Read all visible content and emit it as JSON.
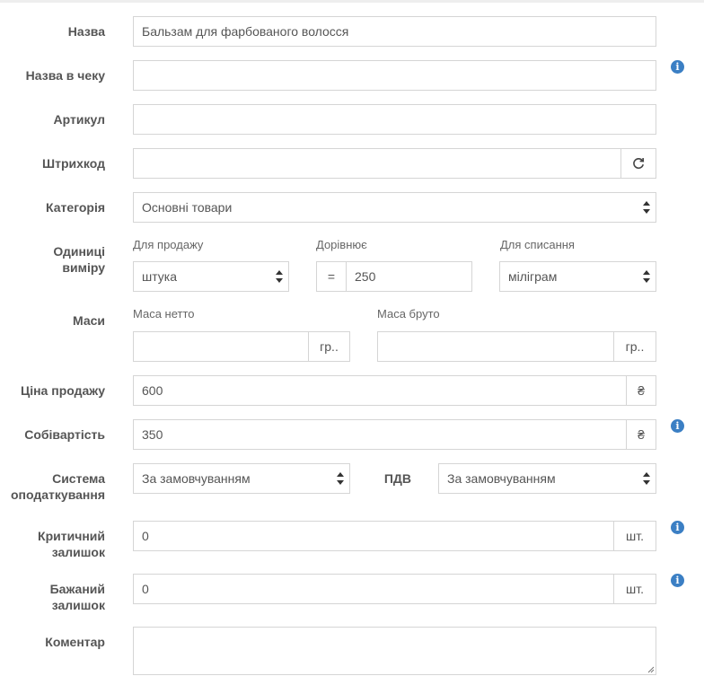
{
  "fields": {
    "name": {
      "label": "Назва",
      "value": "Бальзам для фарбованого волосся"
    },
    "receipt_name": {
      "label": "Назва в чеку",
      "value": ""
    },
    "article": {
      "label": "Артикул",
      "value": ""
    },
    "barcode": {
      "label": "Штрихкод",
      "value": "",
      "refresh_icon": "refresh-icon"
    },
    "category": {
      "label": "Категорія",
      "value": "Основні товари"
    },
    "units": {
      "label_line1": "Одиниці",
      "label_line2": "виміру",
      "sale_label": "Для продажу",
      "sale_value": "штука",
      "equals_label": "Дорівнює",
      "equals_sign": "=",
      "equals_value": "250",
      "writeoff_label": "Для списання",
      "writeoff_value": "міліграм"
    },
    "mass": {
      "label": "Маси",
      "net_label": "Маса нетто",
      "net_value": "",
      "net_unit": "гр..",
      "gross_label": "Маса бруто",
      "gross_value": "",
      "gross_unit": "гр.."
    },
    "price": {
      "label": "Ціна продажу",
      "value": "600",
      "currency": "₴"
    },
    "cost": {
      "label": "Собівартість",
      "value": "350",
      "currency": "₴"
    },
    "tax": {
      "label_line1": "Система",
      "label_line2": "оподаткування",
      "value": "За замовчуванням",
      "vat_label": "ПДВ",
      "vat_value": "За замовчуванням"
    },
    "critical_stock": {
      "label_line1": "Критичний",
      "label_line2": "залишок",
      "value": "0",
      "unit": "шт."
    },
    "desired_stock": {
      "label_line1": "Бажаний",
      "label_line2": "залишок",
      "value": "0",
      "unit": "шт."
    },
    "comment": {
      "label": "Коментар",
      "value": ""
    }
  },
  "icons": {
    "info": "i"
  },
  "colors": {
    "info_blue": "#3b7fc4",
    "border": "#d5d5d5",
    "label_text": "#555555"
  }
}
